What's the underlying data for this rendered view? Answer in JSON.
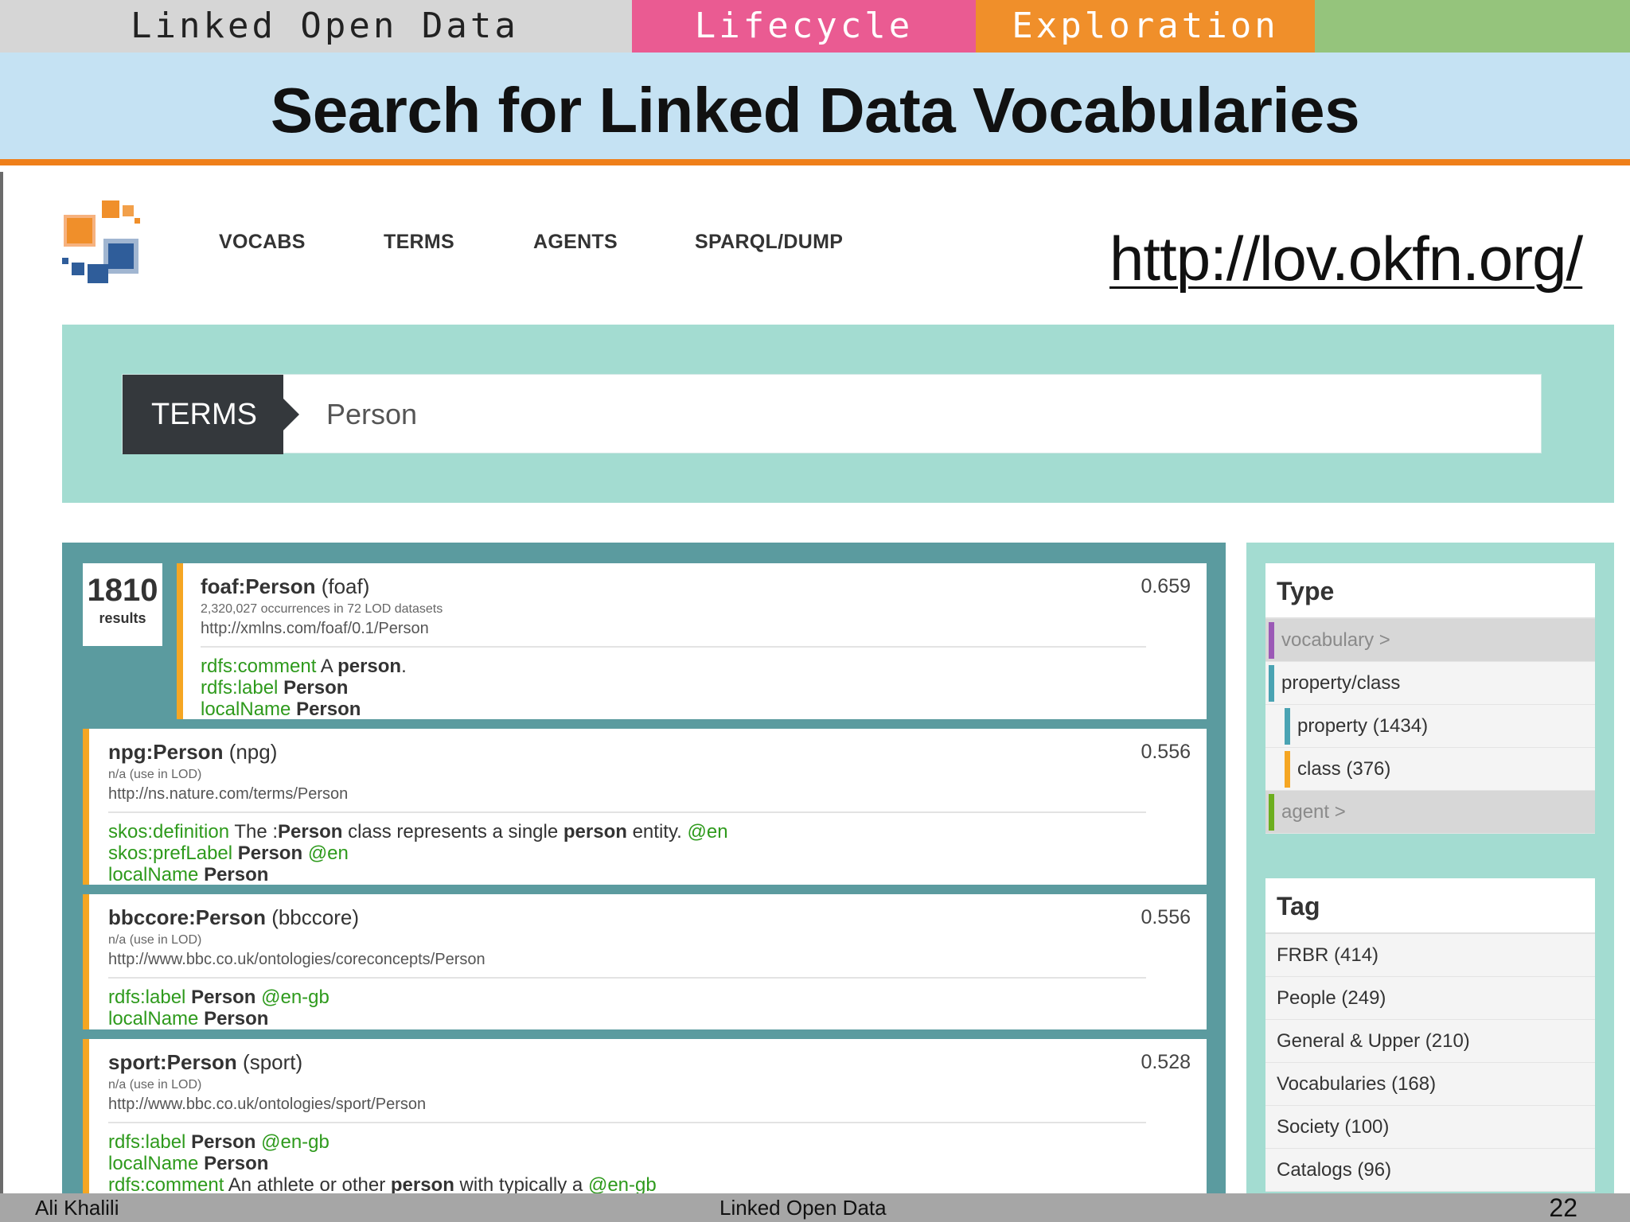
{
  "slide": {
    "topbar": {
      "lod": "Linked Open Data",
      "lifecycle": "Lifecycle",
      "exploration": "Exploration"
    },
    "title": "Search for Linked Data Vocabularies",
    "url": "http://lov.okfn.org/",
    "footer": {
      "author": "Ali Khalili",
      "center": "Linked Open Data",
      "page": "22"
    }
  },
  "nav": {
    "vocabs": "VOCABS",
    "terms": "TERMS",
    "agents": "AGENTS",
    "sparql": "SPARQL/DUMP"
  },
  "search": {
    "tag": "TERMS",
    "value": "Person"
  },
  "results": {
    "count": "1810",
    "count_label": "results",
    "items": [
      {
        "name": "foaf:Person",
        "prefix": "(foaf)",
        "score": "0.659",
        "occ": "2,320,027 occurrences in 72 LOD datasets",
        "uri": "http://xmlns.com/foaf/0.1/Person",
        "p1_key": "rdfs:comment",
        "p1_a": "A",
        "p1_b": "person",
        "p1_c": ".",
        "p2_key": "rdfs:label",
        "p2_b": "Person",
        "p3_key": "localName",
        "p3_b": "Person"
      },
      {
        "name": "npg:Person",
        "prefix": "(npg)",
        "score": "0.556",
        "occ": "n/a (use in LOD)",
        "uri": "http://ns.nature.com/terms/Person",
        "p1_key": "skos:definition",
        "p1_a": "The :",
        "p1_b": "Person",
        "p1_c": "class represents a single",
        "p1_d": "person",
        "p1_e": "entity.",
        "p1_lang": "@en",
        "p2_key": "skos:prefLabel",
        "p2_b": "Person",
        "p2_lang": "@en",
        "p3_key": "localName",
        "p3_b": "Person"
      },
      {
        "name": "bbccore:Person",
        "prefix": "(bbccore)",
        "score": "0.556",
        "occ": "n/a (use in LOD)",
        "uri": "http://www.bbc.co.uk/ontologies/coreconcepts/Person",
        "p1_key": "rdfs:label",
        "p1_b": "Person",
        "p1_lang": "@en-gb",
        "p2_key": "localName",
        "p2_b": "Person"
      },
      {
        "name": "sport:Person",
        "prefix": "(sport)",
        "score": "0.528",
        "occ": "n/a (use in LOD)",
        "uri": "http://www.bbc.co.uk/ontologies/sport/Person",
        "p1_key": "rdfs:label",
        "p1_b": "Person",
        "p1_lang": "@en-gb",
        "p2_key": "localName",
        "p2_b": "Person",
        "p3_key": "rdfs:comment",
        "p3_a": "An athlete or other",
        "p3_b": "person",
        "p3_c": "with typically a",
        "p3_lang": "@en-gb"
      }
    ]
  },
  "facets": {
    "type": {
      "heading": "Type",
      "vocabulary": "vocabulary >",
      "propclass": "property/class",
      "property": "property (1434)",
      "class": "class (376)",
      "agent": "agent >"
    },
    "tag": {
      "heading": "Tag",
      "items": [
        "FRBR (414)",
        "People (249)",
        "General & Upper (210)",
        "Vocabularies (168)",
        "Society (100)",
        "Catalogs (96)"
      ]
    }
  },
  "colors": {
    "lifecycle": "#ea5b92",
    "exploration": "#f08f2a",
    "green_tab": "#95c47c",
    "title_band": "#c5e2f3",
    "accent_line": "#ef7f1a",
    "search_band": "#a3dcd1",
    "results_bg": "#5b9b9f",
    "card_accent": "#f5a623",
    "prop_key": "#2e9a1c",
    "bar_vocabulary": "#9b59b6",
    "bar_property": "#4aa3b3",
    "bar_class": "#f5a623",
    "bar_agent": "#6cae1e"
  }
}
